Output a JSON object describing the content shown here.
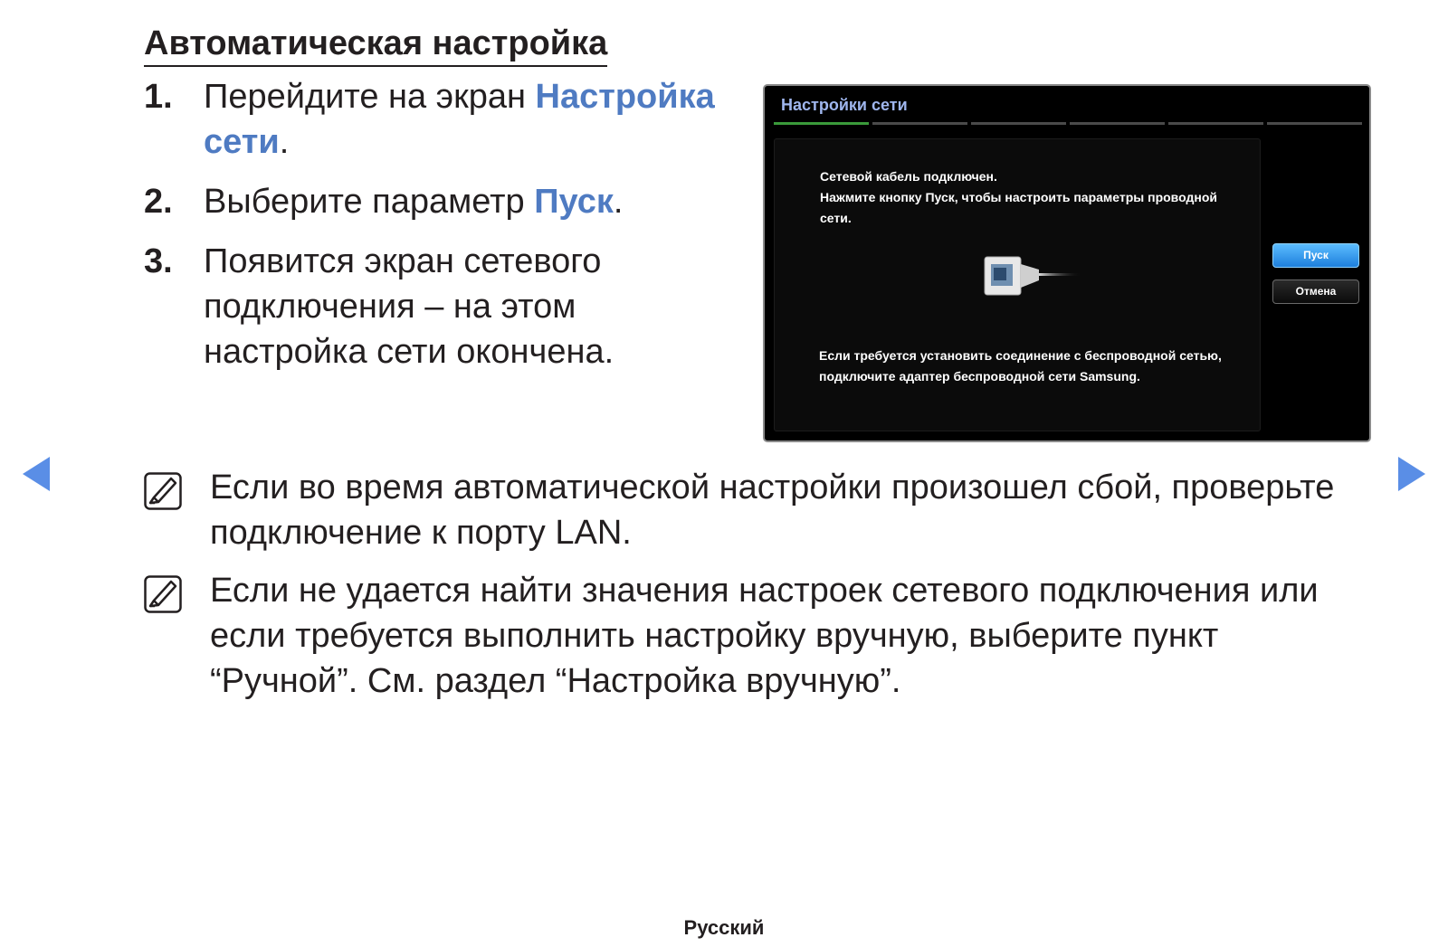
{
  "title": "Автоматическая настройка",
  "steps": [
    {
      "num": "1.",
      "before": "Перейдите на экран ",
      "highlight": "Настройка сети",
      "after": "."
    },
    {
      "num": "2.",
      "before": "Выберите параметр ",
      "highlight": "Пуск",
      "after": "."
    },
    {
      "num": "3.",
      "text": "Появится экран сетевого подключения – на этом настройка сети окончена."
    }
  ],
  "tv_screen": {
    "title": "Настройки сети",
    "progress": {
      "current_step": 1,
      "total_steps": 6
    },
    "message_lines": [
      "Сетевой кабель подключен.",
      "Нажмите кнопку Пуск, чтобы настроить параметры проводной сети."
    ],
    "wireless_hint": "Если требуется установить соединение с беспроводной сетью, подключите адаптер беспроводной сети Samsung.",
    "buttons": {
      "start": "Пуск",
      "cancel": "Отмена"
    },
    "illustration": "lan-cable-icon"
  },
  "notes": [
    "Если во время автоматической настройки произошел сбой, проверьте подключение к порту LAN.",
    "Если не удается найти значения настроек сетевого подключения или если требуется выполнить настройку вручную, выберите пункт “Ручной”. См. раздел “Настройка вручную”."
  ],
  "footer": {
    "language": "Русский"
  },
  "colors": {
    "highlight": "#4f7bc2",
    "nav_arrow": "#5a8ee6",
    "tv_title": "#9fb6ee",
    "start_button": "#2e93ea"
  },
  "icons": {
    "prev": "triangle-left-icon",
    "next": "triangle-right-icon",
    "note": "note-pencil-icon"
  }
}
